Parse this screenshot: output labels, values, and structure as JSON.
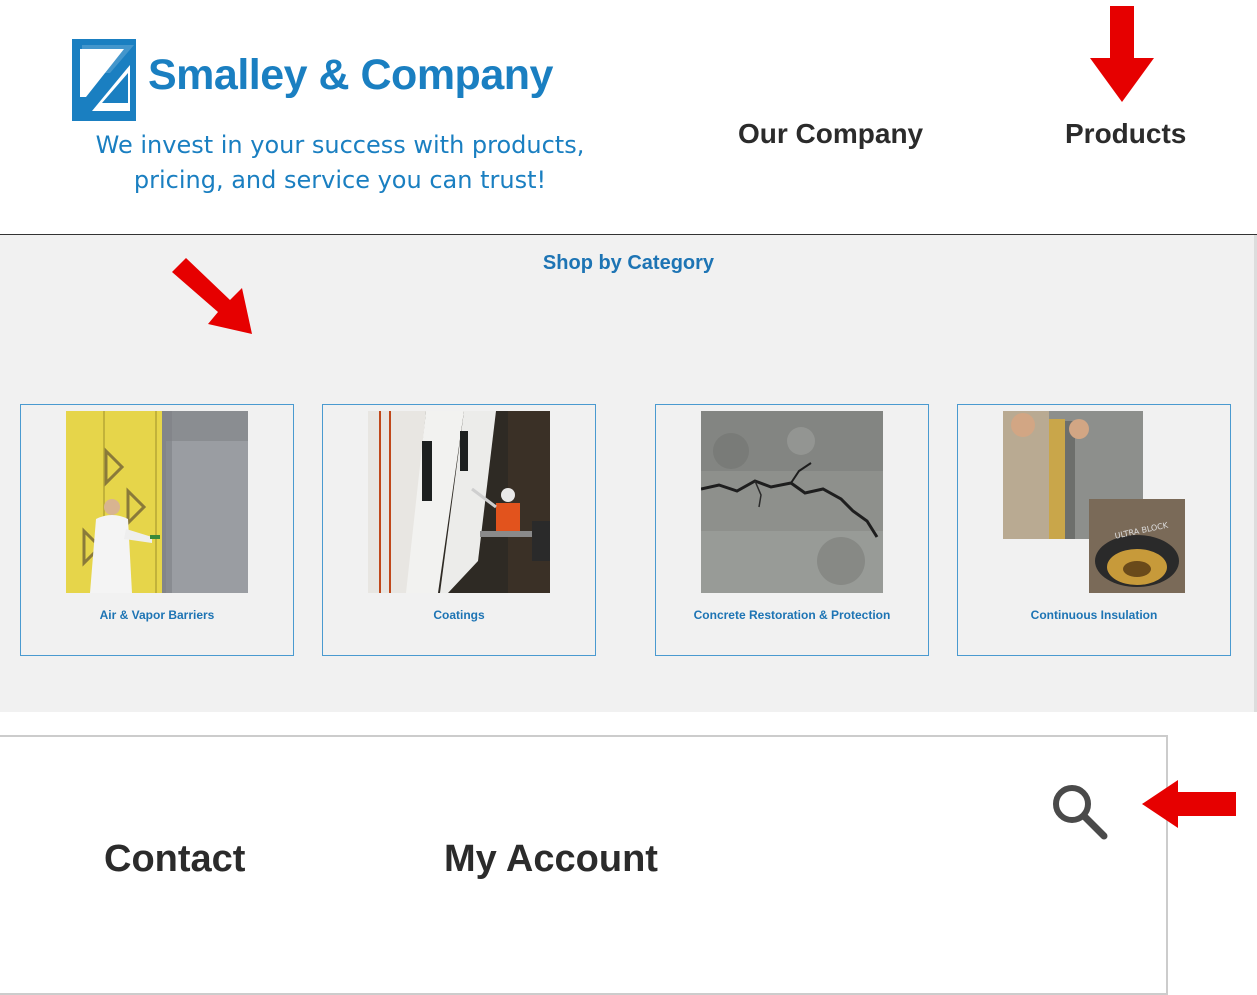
{
  "brand": {
    "name": "Smalley & Company",
    "tagline_line1": "We invest in your success with products,",
    "tagline_line2": "pricing, and service you can trust!",
    "color": "#1a7fc1"
  },
  "nav": {
    "our_company": "Our Company",
    "products": "Products"
  },
  "shop": {
    "title": "Shop by Category",
    "categories": [
      {
        "label": "Air & Vapor Barriers",
        "image": "air-vapor-barrier-photo"
      },
      {
        "label": "Coatings",
        "image": "coatings-photo"
      },
      {
        "label": "Concrete Restoration & Protection",
        "image": "cracked-concrete-photo"
      },
      {
        "label": "Continuous Insulation",
        "image": "insulation-photo"
      }
    ]
  },
  "menu": {
    "contact": "Contact",
    "my_account": "My Account",
    "search_icon": "search-icon"
  },
  "annotations": {
    "arrow_color": "#e60000",
    "arrows": [
      "arrow-down",
      "arrow-down-right",
      "arrow-left"
    ]
  }
}
